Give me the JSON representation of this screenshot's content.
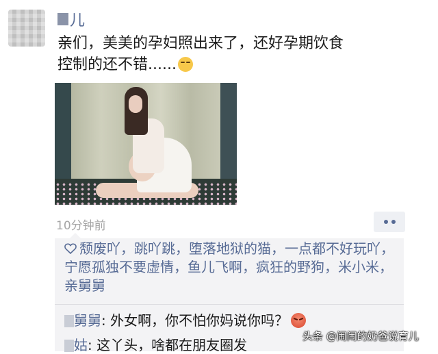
{
  "post": {
    "nickname": "儿",
    "text_line1": "亲们，美美的孕妇照出来了，还好孕期饮食",
    "text_line2": "控制的还不错......",
    "emoji": "smug-face-emoji",
    "photo_alt": "pregnancy-photo",
    "time": "10分钟前"
  },
  "likes": {
    "icon": "heart-icon",
    "names": "颓废吖，跳吖跳，堕落地狱的猫，一点都不好玩吖，宁愿孤独不要虚情，鱼儿飞啊，疯狂的野狗，米小米，亲舅舅"
  },
  "comments": [
    {
      "author": "舅舅",
      "text": ": 外女啊，你不怕你妈说你吗？",
      "emoji": "angry-face-emoji"
    },
    {
      "author": "姑",
      "text": ": 这丫头，啥都在朋友圈发"
    }
  ],
  "watermark": "头条 @闹闹的奶爸说育儿",
  "colors": {
    "link": "#576b95",
    "panel": "#f3f3f5",
    "time": "#a6a6a6"
  }
}
